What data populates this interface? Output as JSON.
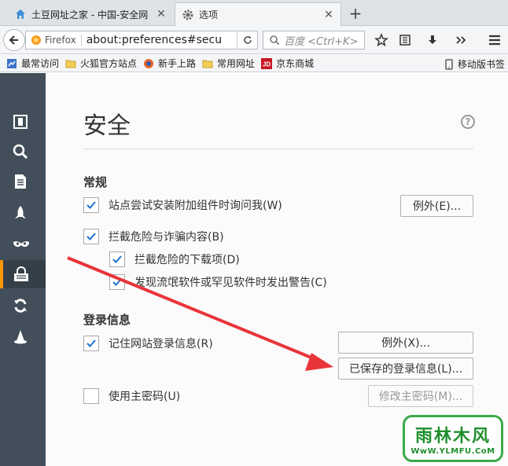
{
  "tabs": [
    {
      "label": "土豆网址之家 - 中国-安全网",
      "active": false
    },
    {
      "label": "选项",
      "active": true
    }
  ],
  "navbar": {
    "identity_label": "Firefox",
    "url": "about:preferences#secu",
    "search_placeholder": "百度 <Ctrl+K>"
  },
  "bookmarks": {
    "items": [
      "最常访问",
      "火狐官方站点",
      "新手上路",
      "常用网址",
      "京东商城"
    ],
    "mobile": "移动版书签"
  },
  "sidebar": {
    "items": [
      "general",
      "search",
      "content",
      "applications",
      "privacy",
      "security",
      "sync",
      "advanced"
    ],
    "active_index": 5
  },
  "page": {
    "title": "安全",
    "help": "?",
    "section_general": "常规",
    "addon_warn": "站点尝试安装附加组件时询问我(W)",
    "addon_exceptions": "例外(E)...",
    "block_dangerous": "拦截危险与诈骗内容(B)",
    "block_downloads": "拦截危险的下载项(D)",
    "warn_unwanted": "发现流氓软件或罕见软件时发出警告(C)",
    "section_logins": "登录信息",
    "remember_logins": "记住网站登录信息(R)",
    "login_exceptions": "例外(X)...",
    "saved_logins": "已保存的登录信息(L)...",
    "master_password": "使用主密码(U)",
    "change_master": "修改主密码(M)..."
  },
  "colors": {
    "sidebar_bg": "#424f5a",
    "sidebar_active_accent": "#ff9500",
    "check": "#1a73c9",
    "arrow": "#e8353a"
  },
  "watermark": {
    "logo": "雨林木风",
    "url": "WwW.YLMFU.CoM"
  }
}
